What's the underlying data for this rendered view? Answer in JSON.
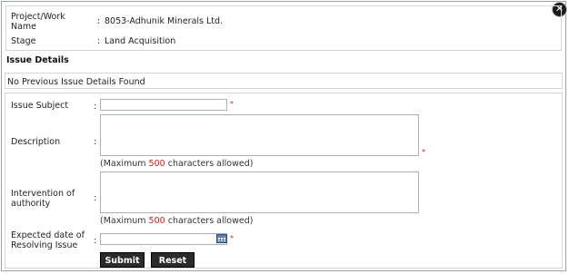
{
  "header": {
    "project_label": "Project/Work Name",
    "project_value": "8053-Adhunik Minerals Ltd.",
    "stage_label": "Stage",
    "stage_value": "Land Acquisition",
    "separator": ":"
  },
  "issue_details": {
    "title": "Issue Details",
    "no_previous": "No Previous Issue Details Found"
  },
  "form": {
    "subject_label": "Issue Subject",
    "description_label": "Description",
    "intervention_label": "Intervention of authority",
    "expected_date_label": "Expected date of Resolving Issue",
    "required_mark": "*",
    "hint_prefix": "(Maximum",
    "hint_max": "500",
    "hint_suffix": "characters allowed)",
    "subject_value": "",
    "description_value": "",
    "intervention_value": "",
    "date_value": ""
  },
  "buttons": {
    "submit": "Submit",
    "reset": "Reset"
  },
  "icons": {
    "close": "close-icon",
    "calendar": "calendar-icon"
  }
}
